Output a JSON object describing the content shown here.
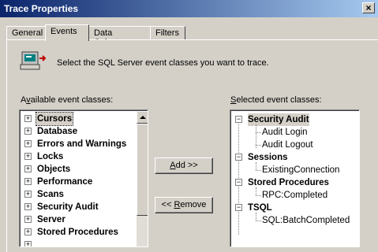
{
  "window": {
    "title": "Trace Properties",
    "close_label": "×"
  },
  "tabs": [
    {
      "label": "General"
    },
    {
      "label": "Events"
    },
    {
      "label": "Data Columns"
    },
    {
      "label": "Filters"
    }
  ],
  "active_tab": "Events",
  "hint": {
    "text": "Select the SQL Server event classes you want to trace.",
    "icon": "trace-events-icon"
  },
  "available": {
    "label_accel": "v",
    "label_pre": "A",
    "label_post": "ailable event classes:",
    "items": [
      "Cursors",
      "Database",
      "Errors and Warnings",
      "Locks",
      "Objects",
      "Performance",
      "Scans",
      "Security Audit",
      "Server",
      "Stored Procedures"
    ],
    "focused_item": "Cursors"
  },
  "selected": {
    "label_accel": "S",
    "label_post": "elected event classes:",
    "groups": [
      {
        "label": "Security Audit",
        "children": [
          "Audit Login",
          "Audit Logout"
        ]
      },
      {
        "label": "Sessions",
        "children": [
          "ExistingConnection"
        ]
      },
      {
        "label": "Stored Procedures",
        "children": [
          "RPC:Completed"
        ]
      },
      {
        "label": "TSQL",
        "children": [
          "SQL:BatchCompleted"
        ]
      }
    ],
    "highlighted_item": "Security Audit"
  },
  "buttons": {
    "add_accel": "A",
    "add_post": "dd >>",
    "remove_pre": "<< ",
    "remove_accel": "R",
    "remove_post": "emove"
  },
  "colors": {
    "titlebar_start": "#0a246a",
    "titlebar_end": "#a6caf0",
    "face": "#d4d0c8"
  }
}
